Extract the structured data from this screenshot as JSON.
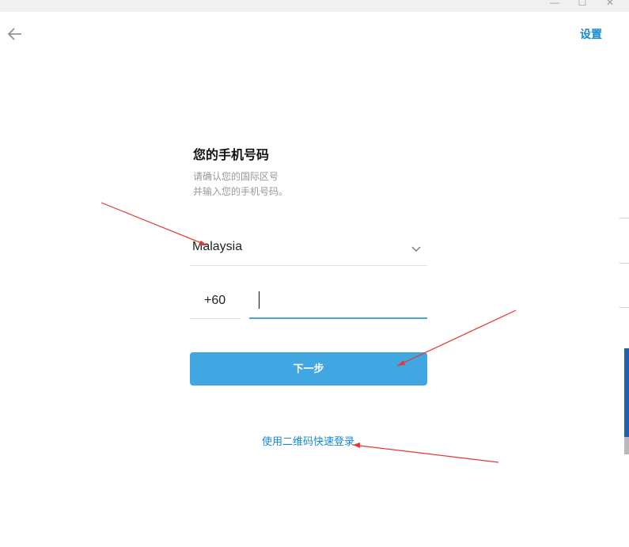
{
  "window": {
    "minimize_glyph": "—",
    "maximize_glyph": "☐",
    "close_glyph": "✕"
  },
  "header": {
    "back_icon": "arrow-left-icon",
    "settings_label": "设置"
  },
  "login": {
    "title": "您的手机号码",
    "description_line1": "请确认您的国际区号",
    "description_line2": "并输入您的手机号码。",
    "country": "Malaysia",
    "country_code": "+60",
    "phone_value": "",
    "next_label": "下一步",
    "qr_login_label": "使用二维码快速登录"
  },
  "colors": {
    "accent": "#40a7e3",
    "link": "#168acd",
    "annotation_arrow": "#e53935"
  }
}
